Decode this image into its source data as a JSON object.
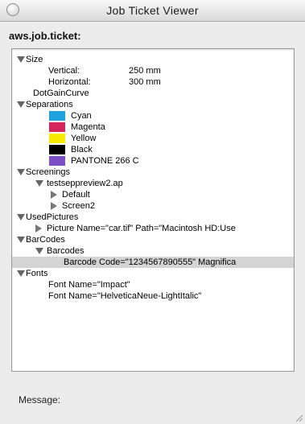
{
  "window": {
    "title": "Job Ticket Viewer"
  },
  "path_label": "aws.job.ticket:",
  "tree": {
    "size": "Size",
    "vertical_label": "Vertical:",
    "vertical_value": "250 mm",
    "horizontal_label": "Horizontal:",
    "horizontal_value": "300 mm",
    "dot_gain": "DotGainCurve",
    "separations": "Separations",
    "cyan": "Cyan",
    "magenta": "Magenta",
    "yellow": "Yellow",
    "black": "Black",
    "pantone": "PANTONE 266 C",
    "screenings": "Screenings",
    "screening_file": "testseppreview2.ap",
    "default": "Default",
    "screen2": "Screen2",
    "used_pictures": "UsedPictures",
    "picture": "Picture Name=\"car.tif\" Path=\"Macintosh HD:Use",
    "barcodes_root": "BarCodes",
    "barcodes": "Barcodes",
    "barcode": "Barcode Code=\"1234567890555\" Magnifica",
    "fonts": "Fonts",
    "font1": "Font Name=\"Impact\"",
    "font2": "Font Name=\"HelveticaNeue-LightItalic\""
  },
  "swatch_colors": {
    "cyan": "#1fa3e0",
    "magenta": "#d6245f",
    "yellow": "#f7ea00",
    "black": "#000000",
    "pantone": "#7a4fc4"
  },
  "message_label": "Message:"
}
